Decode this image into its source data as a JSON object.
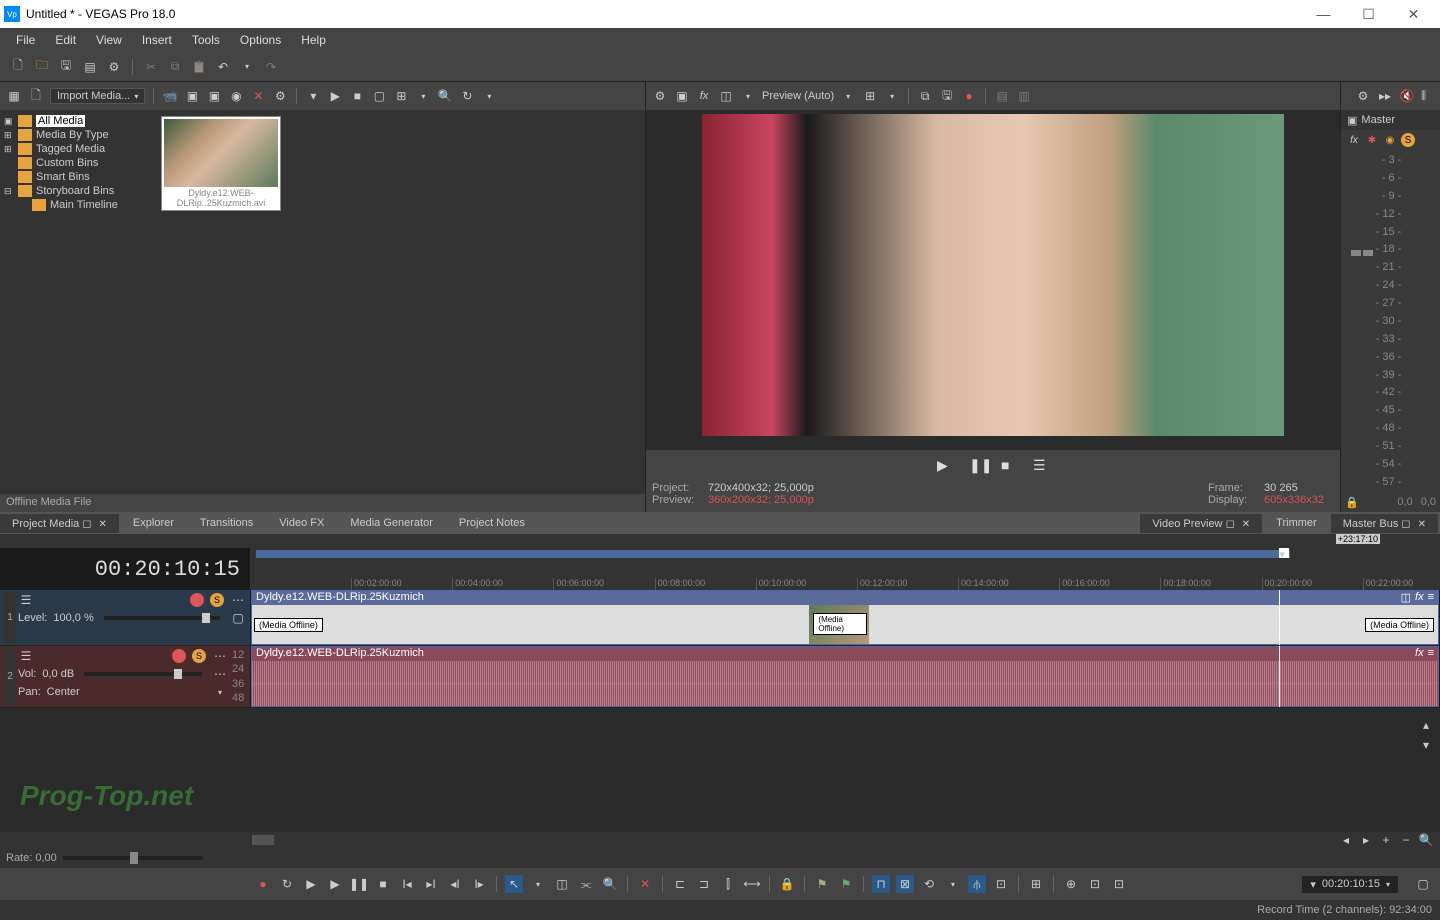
{
  "window": {
    "title": "Untitled * - VEGAS Pro 18.0",
    "appicon_text": "Vp"
  },
  "menu": [
    "File",
    "Edit",
    "View",
    "Insert",
    "Tools",
    "Options",
    "Help"
  ],
  "media_panel": {
    "import_label": "Import Media...",
    "tree": [
      {
        "label": "All Media",
        "selected": true
      },
      {
        "label": "Media By Type"
      },
      {
        "label": "Tagged Media"
      },
      {
        "label": "Custom Bins"
      },
      {
        "label": "Smart Bins"
      },
      {
        "label": "Storyboard Bins"
      },
      {
        "label": "Main Timeline",
        "indent": true
      }
    ],
    "thumb_label": "Dyldy.e12.WEB-DLRip..25Kuzmich.avi",
    "status": "Offline Media File"
  },
  "preview": {
    "mode_label": "Preview (Auto)",
    "project_label": "Project:",
    "project_val": "720x400x32; 25,000p",
    "preview_label": "Preview:",
    "preview_val": "360x200x32; 25,000p",
    "frame_label": "Frame:",
    "frame_val": "30 265",
    "display_label": "Display:",
    "display_val": "605x336x32"
  },
  "master": {
    "title": "Master",
    "scale": [
      "- 3 -",
      "- 6 -",
      "- 9 -",
      "- 12 -",
      "- 15 -",
      "- 18 -",
      "- 21 -",
      "- 24 -",
      "- 27 -",
      "- 30 -",
      "- 33 -",
      "- 36 -",
      "- 39 -",
      "- 42 -",
      "- 45 -",
      "- 48 -",
      "- 51 -",
      "- 54 -",
      "- 57 -"
    ],
    "footer": "0,0"
  },
  "tabs": {
    "upper_left": [
      "Project Media",
      "Explorer",
      "Transitions",
      "Video FX",
      "Media Generator",
      "Project Notes"
    ],
    "upper_mid": [
      "Video Preview",
      "Trimmer"
    ],
    "upper_right": [
      "Master Bus"
    ]
  },
  "timeline": {
    "timecode": "00:20:10:15",
    "end_marker": "+23:17:10",
    "ruler": [
      "00:02:00:00",
      "00:04:00:00",
      "00:06:00:00",
      "00:08:00:00",
      "00:10:00:00",
      "00:12:00:00",
      "00:14:00:00",
      "00:16:00:00",
      "00:18:00:00",
      "00:20:00:00",
      "00:22:00:00"
    ],
    "track1": {
      "num": "1",
      "level_label": "Level:",
      "level_val": "100,0 %",
      "clip_name": "Dyldy.e12.WEB-DLRip.25Kuzmich",
      "offline": "(Media Offline)"
    },
    "track2": {
      "num": "2",
      "vol_label": "Vol:",
      "vol_val": "0,0 dB",
      "pan_label": "Pan:",
      "pan_val": "Center",
      "clip_name": "Dyldy.e12.WEB-DLRip.25Kuzmich",
      "db_labels": [
        "12",
        "24",
        "36",
        "48"
      ]
    },
    "rate_label": "Rate: 0,00"
  },
  "bottom": {
    "timecode": "00:20:10:15"
  },
  "status_bar": {
    "text": "Record Time (2 channels): 92:34:00"
  },
  "watermark": "Prog-Top.net"
}
